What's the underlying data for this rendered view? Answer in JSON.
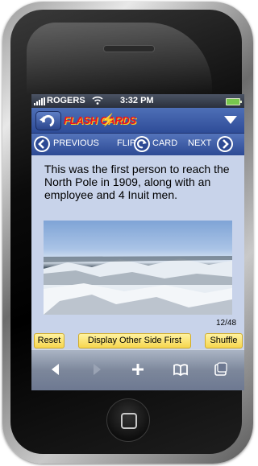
{
  "status": {
    "carrier": "ROGERS",
    "time": "3:32 PM"
  },
  "app": {
    "logo_text": "FLASH CARDS"
  },
  "nav": {
    "previous_label": "PREVIOUS",
    "flip_label": "FLIP",
    "card_label": "CARD",
    "next_label": "NEXT"
  },
  "card": {
    "text": "This was the first person to reach the North Pole in 1909, along with an employee and 4 Inuit men.",
    "counter": "12/48"
  },
  "actions": {
    "reset_label": "Reset",
    "display_other_label": "Display Other Side First",
    "shuffle_label": "Shuffle"
  },
  "icons": [
    "back-icon",
    "forward-icon",
    "add-icon",
    "bookmarks-icon",
    "pages-icon"
  ],
  "colors": {
    "accent": "#3a5aa8",
    "button_yellow": "#f6d64e",
    "logo_red": "#e8131f"
  }
}
